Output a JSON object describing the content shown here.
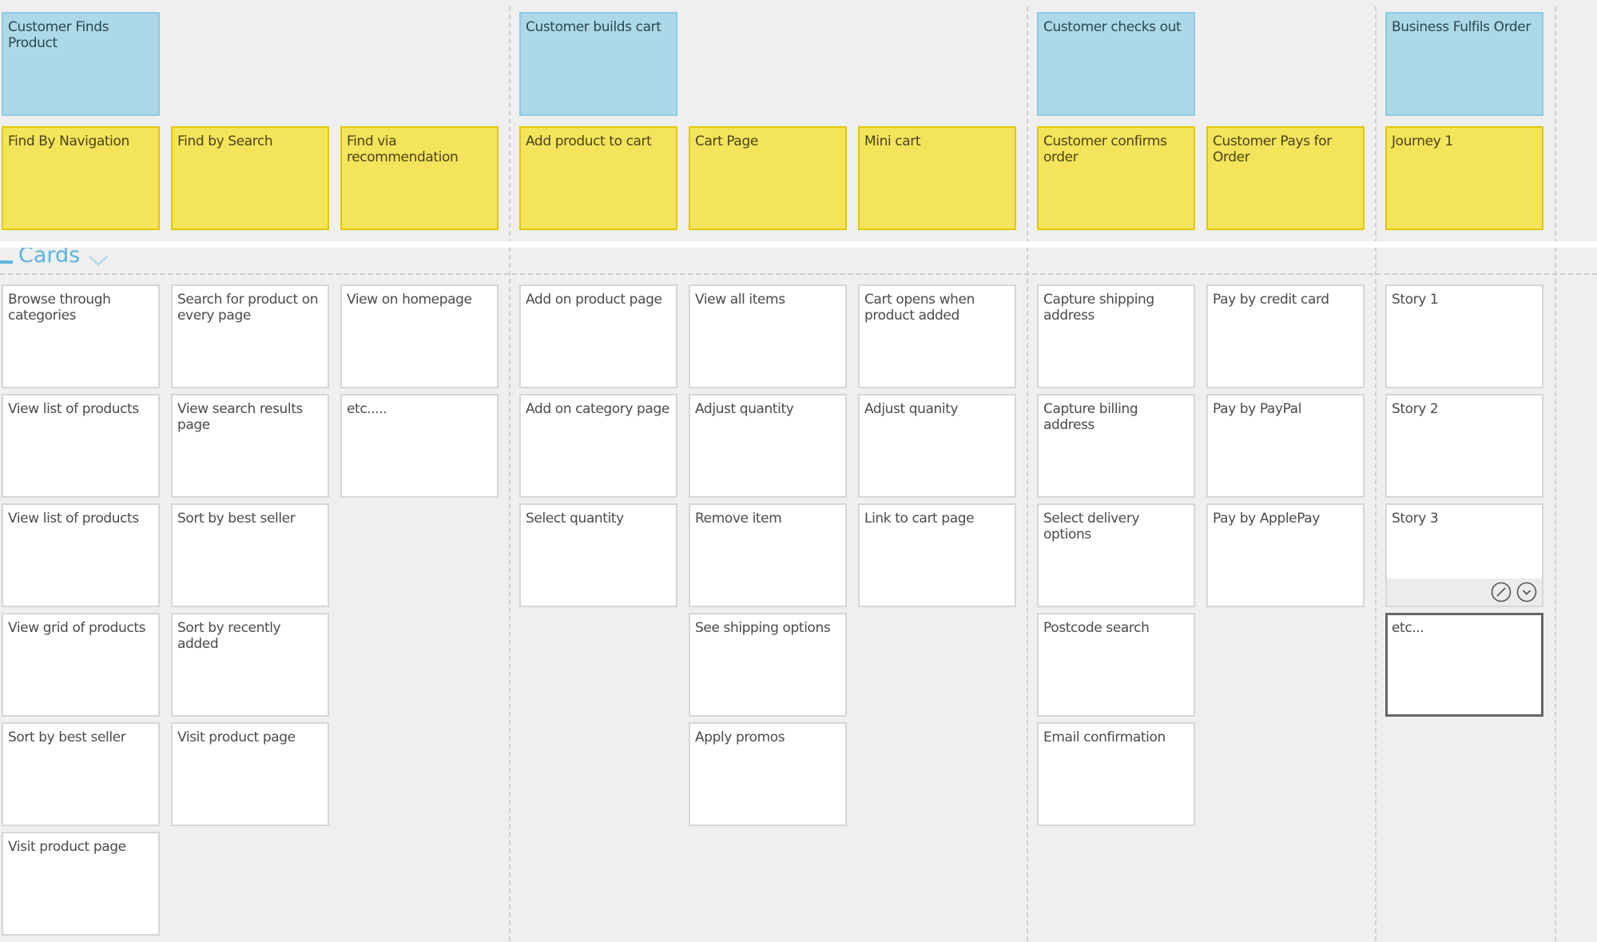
{
  "board": {
    "release": {
      "title": "Cards",
      "collapse_icon": "minus-icon",
      "toggle_icon": "chevron-down-icon"
    },
    "activities": [
      {
        "title": "Customer Finds Product",
        "tasks": [
          {
            "title": "Find By Navigation",
            "stories": [
              "Browse through categories",
              "View list of products",
              "View list of products",
              "View grid of products",
              "Sort by best seller",
              "Visit product page"
            ]
          },
          {
            "title": "Find by Search",
            "stories": [
              "Search for product on every page",
              "View search results page",
              "Sort by best seller",
              "Sort by recently added",
              "Visit product page"
            ]
          },
          {
            "title": "Find via recommendation",
            "stories": [
              "View on homepage",
              "etc....."
            ]
          }
        ]
      },
      {
        "title": "Customer builds cart",
        "tasks": [
          {
            "title": "Add product to cart",
            "stories": [
              "Add on product page",
              "Add on category page",
              "Select quantity"
            ]
          },
          {
            "title": "Cart Page",
            "stories": [
              "View all items",
              "Adjust quantity",
              "Remove item",
              "See shipping options",
              "Apply promos"
            ]
          },
          {
            "title": "Mini cart",
            "stories": [
              "Cart opens when product added",
              "Adjust quanity",
              "Link to cart page"
            ]
          }
        ]
      },
      {
        "title": "Customer checks out",
        "tasks": [
          {
            "title": "Customer confirms order",
            "stories": [
              "Capture shipping address",
              "Capture billing address",
              "Select delivery options",
              "Postcode search",
              "Email confirmation"
            ]
          },
          {
            "title": "Customer Pays for Order",
            "stories": [
              "Pay by credit card",
              "Pay by PayPal",
              "Pay by ApplePay"
            ]
          }
        ]
      },
      {
        "title": "Business Fulfils Order",
        "tasks": [
          {
            "title": "Journey 1",
            "stories": [
              "Story 1",
              "Story 2",
              "Story 3",
              "etc..."
            ]
          }
        ]
      }
    ],
    "hovered_card": {
      "activity": 3,
      "task": 0,
      "story": 2,
      "actions": [
        "edit-icon",
        "chevron-down-icon"
      ]
    },
    "selected_card": {
      "activity": 3,
      "task": 0,
      "story": 3
    },
    "colors": {
      "activity_bg": "#add8e8",
      "task_bg": "#f3e45b",
      "story_bg": "#ffffff",
      "release_accent": "#5bb5dc",
      "selected_border": "#666666"
    }
  }
}
